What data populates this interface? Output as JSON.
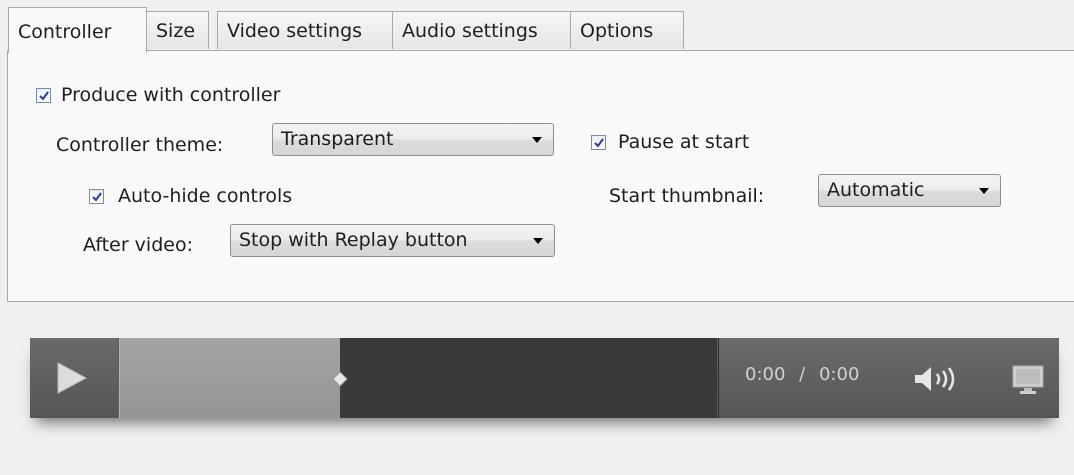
{
  "tabs": [
    {
      "label": "Controller"
    },
    {
      "label": "Size"
    },
    {
      "label": "Video settings"
    },
    {
      "label": "Audio settings"
    },
    {
      "label": "Options"
    }
  ],
  "controller": {
    "produce_with_controller": {
      "label": "Produce with controller",
      "checked": true
    },
    "theme": {
      "label": "Controller theme:",
      "value": "Transparent"
    },
    "auto_hide": {
      "label": "Auto-hide controls",
      "checked": true
    },
    "after_video": {
      "label": "After video:",
      "value": "Stop with Replay button"
    },
    "pause_at_start": {
      "label": "Pause at start",
      "checked": true
    },
    "start_thumbnail": {
      "label": "Start thumbnail:",
      "value": "Automatic"
    }
  },
  "player": {
    "current_time": "0:00",
    "separator": "/",
    "total_time": "0:00",
    "progress_fraction": 0.37,
    "icons": [
      "play-icon",
      "volume-icon",
      "fullscreen-icon"
    ]
  }
}
